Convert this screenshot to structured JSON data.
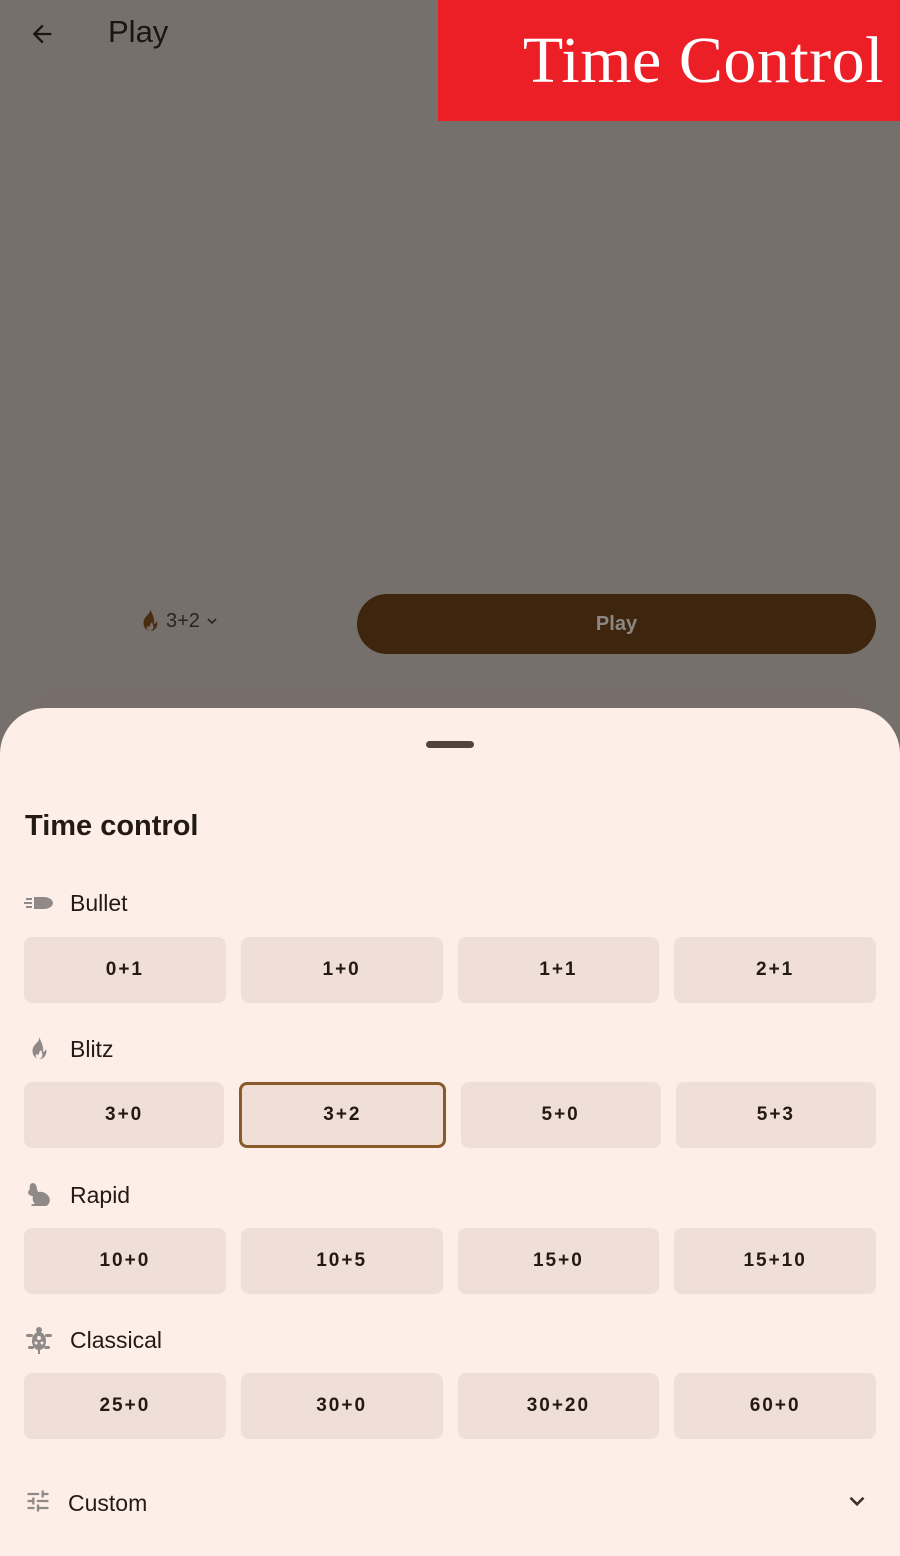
{
  "appbar": {
    "title": "Play",
    "back_icon": "arrow-back-icon"
  },
  "banner": {
    "text": "Time Control",
    "background": "#ec1f27"
  },
  "play_panel": {
    "selected_time_control": "3+2",
    "selected_icon": "fire-icon",
    "play_label": "Play",
    "play_button_color": "#3e260e"
  },
  "sheet": {
    "title": "Time control",
    "categories": [
      {
        "name": "Bullet",
        "icon": "bullet-icon",
        "options": [
          "0+1",
          "1+0",
          "1+1",
          "2+1"
        ]
      },
      {
        "name": "Blitz",
        "icon": "fire-icon",
        "options": [
          "3+0",
          "3+2",
          "5+0",
          "5+3"
        ]
      },
      {
        "name": "Rapid",
        "icon": "rabbit-icon",
        "options": [
          "10+0",
          "10+5",
          "15+0",
          "15+10"
        ]
      },
      {
        "name": "Classical",
        "icon": "turtle-icon",
        "options": [
          "25+0",
          "30+0",
          "30+20",
          "60+0"
        ]
      }
    ],
    "selected": "3+2",
    "selected_border_color": "#8b5a2b",
    "custom": {
      "label": "Custom",
      "icon": "tune-icon",
      "expand_icon": "chevron-down-icon"
    }
  }
}
